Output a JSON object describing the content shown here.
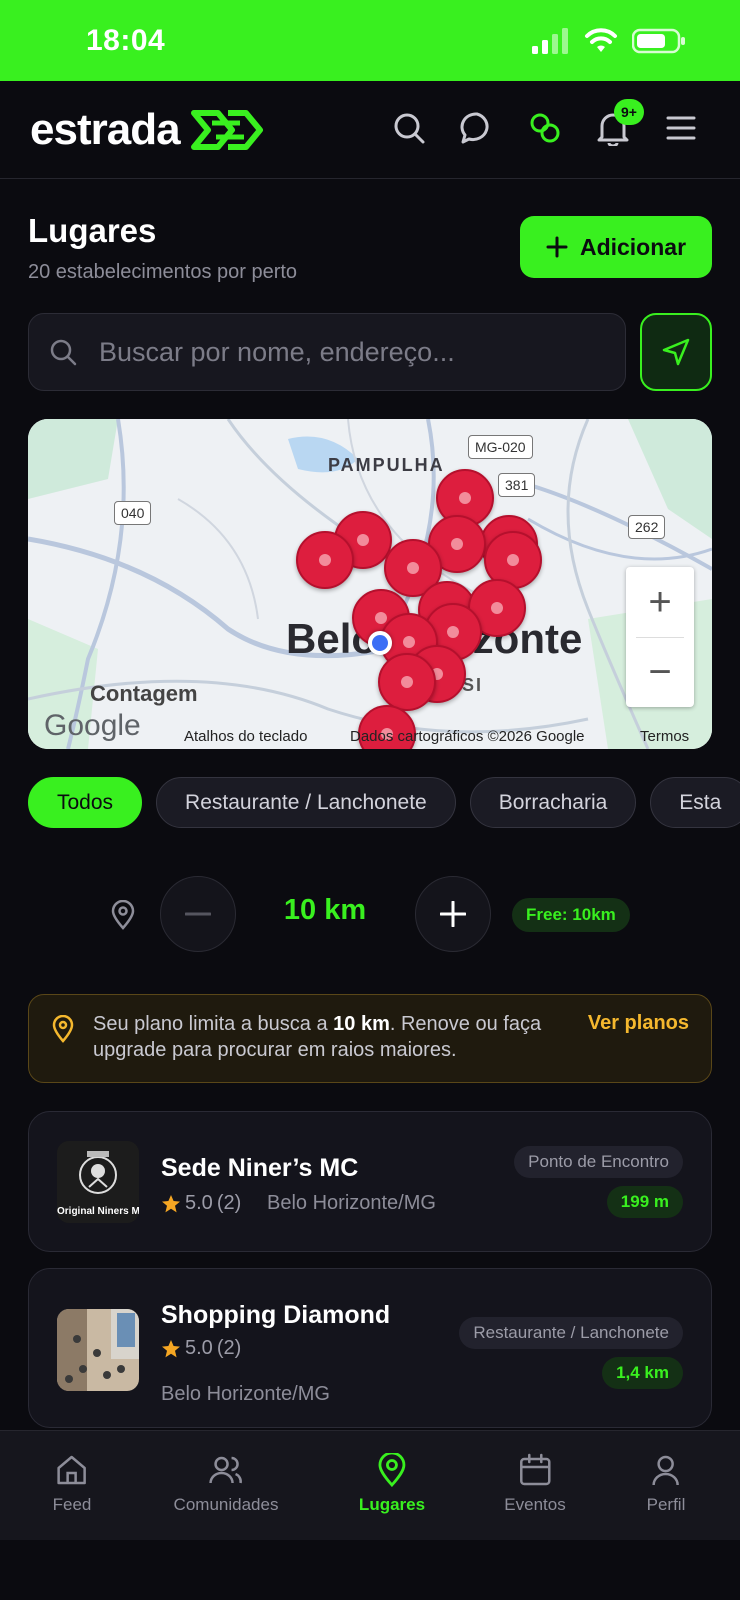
{
  "status_bar": {
    "time": "18:04"
  },
  "header": {
    "logo_text": "estrada",
    "notification_count": "9+"
  },
  "page": {
    "title": "Lugares",
    "subtitle": "20 estabelecimentos por perto",
    "add_label": "Adicionar"
  },
  "search": {
    "placeholder": "Buscar por nome, endereço..."
  },
  "map": {
    "labels": {
      "district_pampulha": "PAMPULHA",
      "city": "Belo Horizonte",
      "contagem": "Contagem",
      "district_ssi": "SSI"
    },
    "road_shields": [
      "MG-020",
      "381",
      "040",
      "262"
    ],
    "attribution": {
      "brand": "Google",
      "shortcuts": "Atalhos do teclado",
      "data": "Dados cartográficos ©2026 Google",
      "terms": "Termos"
    },
    "zoom_in": "+",
    "zoom_out": "−"
  },
  "filters": {
    "chips": [
      "Todos",
      "Restaurante / Lanchonete",
      "Borracharia",
      "Esta"
    ],
    "active": "Todos"
  },
  "radius": {
    "value": "10 km",
    "free_label": "Free: 10km"
  },
  "plan_warning": {
    "text_before": "Seu plano limita a busca a ",
    "text_bold": "10 km",
    "text_after": ". Renove ou faça upgrade para procurar em raios maiores.",
    "link": "Ver planos"
  },
  "places": [
    {
      "name": "Sede Niner’s MC",
      "rating": "5.0",
      "reviews": "(2)",
      "city": "Belo Horizonte/MG",
      "category": "Ponto de Encontro",
      "distance": "199 m",
      "thumb_caption": "Original Niners M"
    },
    {
      "name": "Shopping Diamond",
      "rating": "5.0",
      "reviews": "(2)",
      "city": "Belo Horizonte/MG",
      "category": "Restaurante / Lanchonete",
      "distance": "1,4 km"
    }
  ],
  "bottom_nav": {
    "items": [
      "Feed",
      "Comunidades",
      "Lugares",
      "Eventos",
      "Perfil"
    ],
    "active": "Lugares"
  },
  "colors": {
    "accent": "#39f01f",
    "background": "#0b0b10",
    "warning": "#f5b82e",
    "pin": "#dd1e3e"
  }
}
